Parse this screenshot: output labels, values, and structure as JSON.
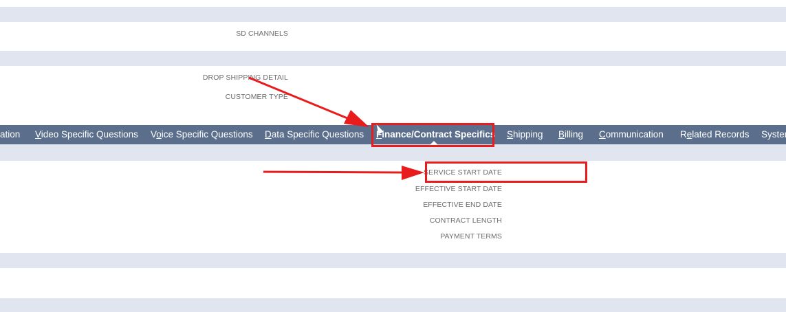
{
  "section1": {
    "fields": [
      {
        "label": "SD CHANNELS"
      }
    ]
  },
  "section2": {
    "fields": [
      {
        "label": "DROP SHIPPING DETAIL"
      },
      {
        "label": "CUSTOMER TYPE"
      }
    ]
  },
  "tabs": [
    {
      "acc": "",
      "rest": "ation"
    },
    {
      "acc": "V",
      "rest": "ideo Specific Questions"
    },
    {
      "pre": "V",
      "acc": "o",
      "rest": "ice Specific Questions"
    },
    {
      "acc": "D",
      "rest": "ata Specific Questions"
    },
    {
      "acc": "F",
      "rest": "inance/Contract Specifics",
      "active": true
    },
    {
      "acc": "S",
      "rest": "hipping"
    },
    {
      "acc": "B",
      "rest": "illing"
    },
    {
      "acc": "C",
      "rest": "ommunication"
    },
    {
      "pre": "R",
      "acc": "e",
      "rest": "lated Records"
    },
    {
      "acc": "",
      "rest": "Syster"
    }
  ],
  "finance_section": {
    "fields": [
      {
        "label": "SERVICE START DATE"
      },
      {
        "label": "EFFECTIVE START DATE"
      },
      {
        "label": "EFFECTIVE END DATE"
      },
      {
        "label": "CONTRACT LENGTH"
      },
      {
        "label": "PAYMENT TERMS"
      }
    ]
  },
  "colors": {
    "band": "#e0e5ef",
    "tabbar": "#5b6f8d",
    "annotation": "#e81c1c",
    "label_text": "#6b6b6b"
  }
}
